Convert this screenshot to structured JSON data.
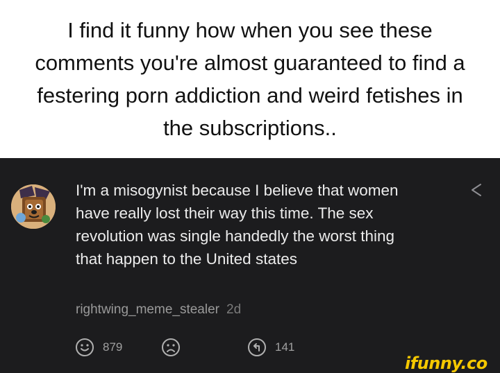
{
  "caption": {
    "text": "I find it funny how when you see these comments you're almost guaranteed to find a festering porn addiction and weird fetishes in the subscriptions.."
  },
  "comment": {
    "text": "I'm a misogynist because I believe that women have really lost their way this time. The sex revolution was single handedly the worst thing that happen to the United states",
    "username": "rightwing_meme_stealer",
    "time": "2d",
    "avatar_icon": "cartoon-dog-avatar-icon",
    "share_icon": "share-icon",
    "actions": {
      "smile_icon": "smile-icon",
      "smile_count": "879",
      "frown_icon": "frown-icon",
      "reply_icon": "reply-icon",
      "reply_count": "141"
    }
  },
  "watermark": {
    "text": "ifunny.co"
  },
  "colors": {
    "panel_background": "#1c1c1e",
    "comment_text": "#ececec",
    "meta_text": "#9a9a9a",
    "watermark": "#f5c800"
  }
}
